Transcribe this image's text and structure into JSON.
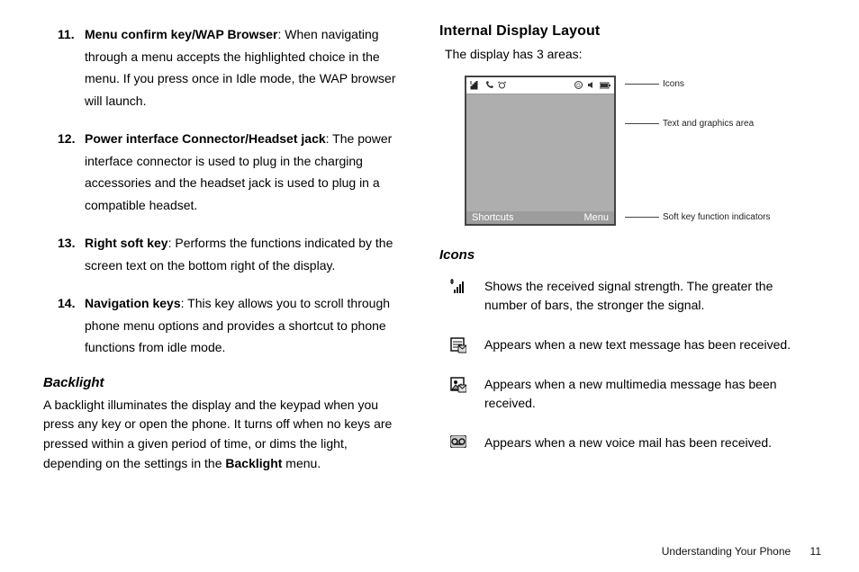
{
  "left": {
    "items": [
      {
        "num": "11.",
        "term": "Menu confirm key/WAP Browser",
        "desc": ": When navigating through a menu accepts the highlighted choice in the menu. If you press once in Idle mode, the WAP browser will launch."
      },
      {
        "num": "12.",
        "term": "Power interface Connector/Headset jack",
        "desc": ": The power interface connector is used to plug in the charging accessories and the headset jack is used to plug in a compatible headset."
      },
      {
        "num": "13.",
        "term": "Right soft key",
        "desc": ": Performs the functions indicated by the screen text on the bottom right of the display."
      },
      {
        "num": "14.",
        "term": "Navigation keys",
        "desc": ": This key allows you to scroll through phone menu options and provides a shortcut to phone functions from idle mode."
      }
    ],
    "backlight_title": "Backlight",
    "backlight_body_pre": "A backlight illuminates the display and the keypad when you press any key or open the phone. It turns off when no keys are pressed within a given period of time, or dims the light, depending on the settings in the ",
    "backlight_body_bold": "Backlight",
    "backlight_body_post": " menu."
  },
  "right": {
    "title": "Internal Display Layout",
    "intro": "The display has 3 areas:",
    "phone": {
      "soft_left": "Shortcuts",
      "soft_right": "Menu"
    },
    "callouts": {
      "icons": "Icons",
      "middle": "Text and graphics area",
      "soft": "Soft key function indicators"
    },
    "icons_title": "Icons",
    "rows": [
      {
        "icon": "signal",
        "desc": "Shows the received signal strength. The greater the number of bars, the stronger the signal."
      },
      {
        "icon": "sms",
        "desc": "Appears when a new text message has been received."
      },
      {
        "icon": "mms",
        "desc": "Appears when a new multimedia message has been received."
      },
      {
        "icon": "vmail",
        "desc": "Appears when a new voice mail has been received."
      }
    ]
  },
  "footer": {
    "section": "Understanding Your Phone",
    "page": "11"
  }
}
